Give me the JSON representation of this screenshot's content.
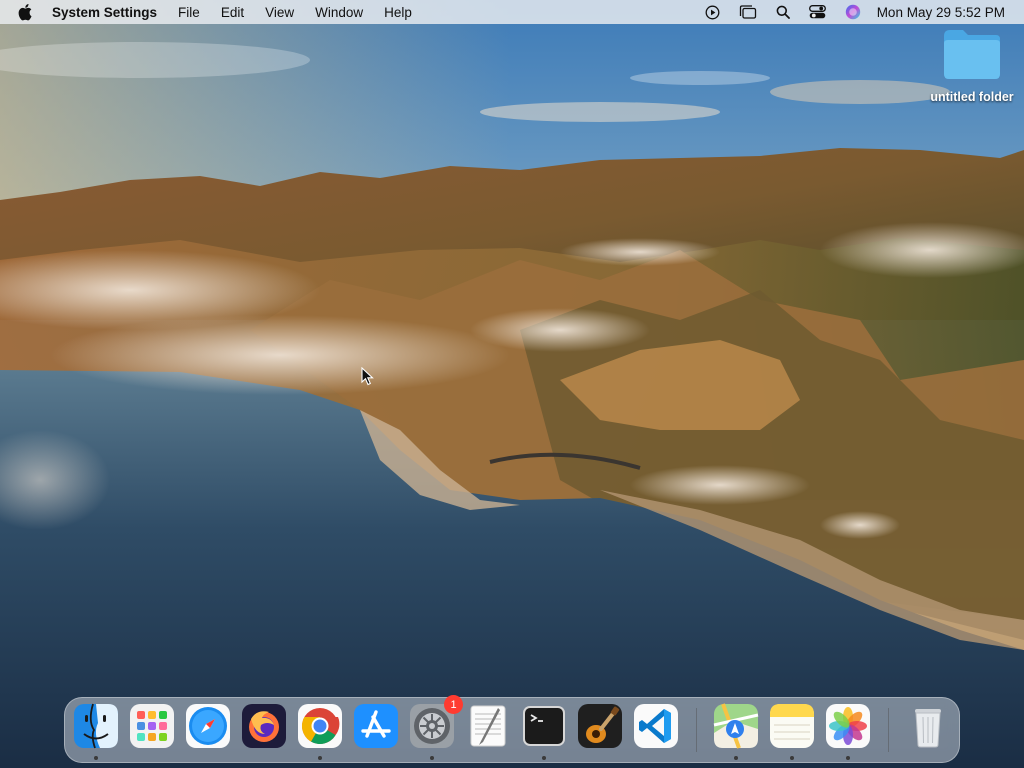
{
  "menubar": {
    "app_name": "System Settings",
    "menus": [
      "File",
      "Edit",
      "View",
      "Window",
      "Help"
    ],
    "clock": "Mon May 29  5:52 PM"
  },
  "desktop": {
    "items": [
      {
        "label": "untitled folder",
        "icon": "folder-icon"
      }
    ]
  },
  "dock": {
    "apps": [
      {
        "icon": "finder-icon",
        "running": true
      },
      {
        "icon": "launchpad-icon",
        "running": false
      },
      {
        "icon": "safari-icon",
        "running": false
      },
      {
        "icon": "firefox-icon",
        "running": false
      },
      {
        "icon": "chrome-icon",
        "running": true
      },
      {
        "icon": "app-store-icon",
        "running": false
      },
      {
        "icon": "system-settings-icon",
        "running": true,
        "badge": "1"
      },
      {
        "icon": "textedit-icon",
        "running": false
      },
      {
        "icon": "terminal-icon",
        "running": true
      },
      {
        "icon": "garageband-icon",
        "running": false
      },
      {
        "icon": "vscode-icon",
        "running": false
      },
      {
        "icon": "maps-icon",
        "running": true
      },
      {
        "icon": "notes-icon",
        "running": true
      },
      {
        "icon": "photos-icon",
        "running": true
      },
      {
        "icon": "trash-icon",
        "running": false
      }
    ]
  }
}
